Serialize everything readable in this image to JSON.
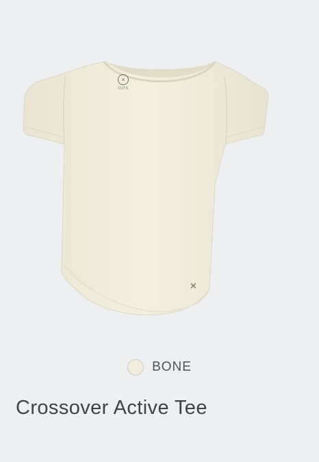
{
  "product": {
    "title": "Crossover Active Tee",
    "color_name": "BONE",
    "swatch_color": "#f1ecdd",
    "garment_color": "#f3efdf",
    "background_color": "#eeeff1",
    "logo_icon": "cuts-logo-icon",
    "logo_text": "CUTS",
    "hem_icon": "crossover-x-icon"
  }
}
